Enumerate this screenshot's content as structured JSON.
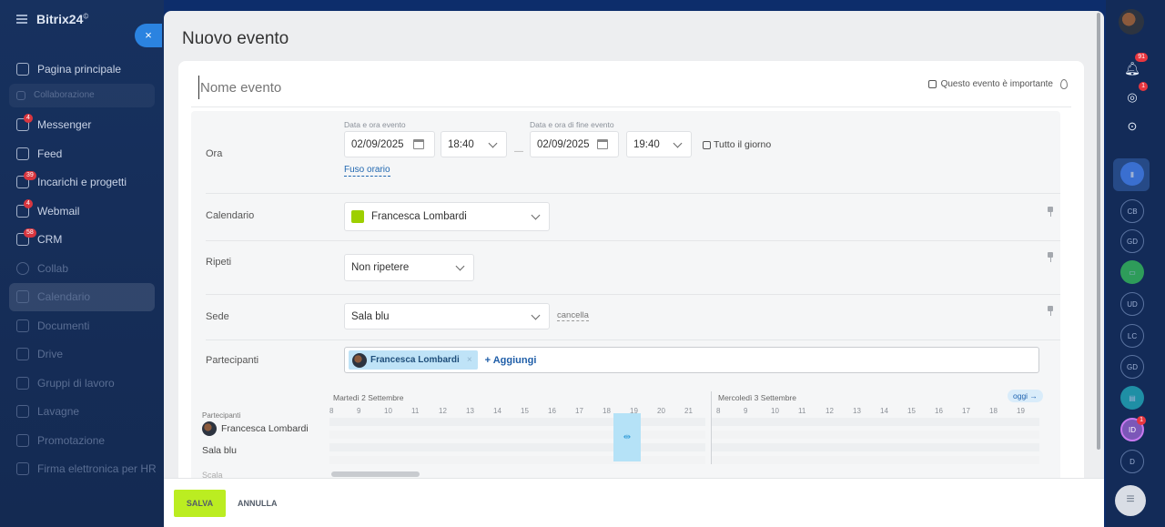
{
  "app": {
    "logo": "Bitrix24",
    "logo_mark": "©"
  },
  "sidebar": {
    "items": [
      {
        "label": "Pagina principale",
        "badge": ""
      },
      {
        "label": "Collaborazione",
        "badge": ""
      },
      {
        "label": "Messenger",
        "badge": "4"
      },
      {
        "label": "Feed",
        "badge": ""
      },
      {
        "label": "Incarichi e progetti",
        "badge": "39"
      },
      {
        "label": "Webmail",
        "badge": "4"
      },
      {
        "label": "CRM",
        "badge": "58"
      },
      {
        "label": "Collab",
        "badge": ""
      },
      {
        "label": "Calendario",
        "badge": ""
      },
      {
        "label": "Documenti",
        "badge": ""
      },
      {
        "label": "Drive",
        "badge": ""
      },
      {
        "label": "Gruppi di lavoro",
        "badge": ""
      },
      {
        "label": "Lavagne",
        "badge": ""
      },
      {
        "label": "Promotazione",
        "badge": ""
      },
      {
        "label": "Firma elettronica per HR",
        "badge": ""
      }
    ],
    "close_label": "×"
  },
  "right_rail": {
    "bell_badge": "91",
    "second_badge": "1",
    "avatars": [
      "CB",
      "GD",
      "UD",
      "LC",
      "GD",
      "ID",
      "D"
    ],
    "id_badge": "1"
  },
  "modal": {
    "title": "Nuovo evento",
    "event_name_placeholder": "Nome evento",
    "important_label": "Questo evento è importante",
    "time": {
      "row_label": "Ora",
      "start_label": "Data e ora evento",
      "end_label": "Data e ora di fine evento",
      "start_date": "02/09/2025",
      "start_time": "18:40",
      "end_date": "02/09/2025",
      "end_time": "19:40",
      "separator": "—",
      "all_day_label": "Tutto il giorno",
      "timezone_link": "Fuso orario"
    },
    "calendar": {
      "row_label": "Calendario",
      "value": "Francesca Lombardi",
      "color": "#9dcf00"
    },
    "repeat": {
      "row_label": "Ripeti",
      "value": "Non ripetere"
    },
    "location": {
      "row_label": "Sede",
      "value": "Sala blu",
      "cancel_link": "cancella"
    },
    "attendees": {
      "row_label": "Partecipanti",
      "chips": [
        {
          "name": "Francesca Lombardi",
          "remove": "×"
        }
      ],
      "add_label": "+ Aggiungi"
    },
    "planner": {
      "day1": "Martedì 2 Settembre",
      "day2": "Mercoledì 3 Settembre",
      "today_button": "oggi →",
      "hours_day1": [
        "8",
        "9",
        "10",
        "11",
        "12",
        "13",
        "14",
        "15",
        "16",
        "17",
        "18",
        "19",
        "20",
        "21"
      ],
      "hours_day2": [
        "8",
        "9",
        "10",
        "11",
        "12",
        "13",
        "14",
        "15",
        "16",
        "17",
        "18",
        "19"
      ],
      "participants_label": "Partecipanti",
      "person": "Francesca Lombardi",
      "room": "Sala blu",
      "scale_label": "Scala",
      "select_glyph": "⇹"
    }
  },
  "footer": {
    "save": "SALVA",
    "cancel": "ANNULLA"
  }
}
